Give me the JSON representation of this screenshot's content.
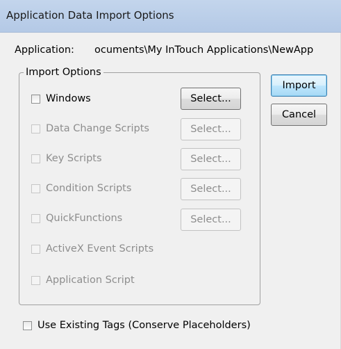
{
  "window": {
    "title": "Application Data Import Options"
  },
  "application": {
    "label": "Application:",
    "path": "ocuments\\My InTouch Applications\\NewApp"
  },
  "import_options": {
    "group_label": "Import Options",
    "items": [
      {
        "label": "Windows",
        "checked": false,
        "enabled": true,
        "select_label": "Select...",
        "select_enabled": true
      },
      {
        "label": "Data Change Scripts",
        "checked": false,
        "enabled": false,
        "select_label": "Select...",
        "select_enabled": false
      },
      {
        "label": "Key Scripts",
        "checked": false,
        "enabled": false,
        "select_label": "Select...",
        "select_enabled": false
      },
      {
        "label": "Condition Scripts",
        "checked": false,
        "enabled": false,
        "select_label": "Select...",
        "select_enabled": false
      },
      {
        "label": "QuickFunctions",
        "checked": false,
        "enabled": false,
        "select_label": "Select...",
        "select_enabled": false
      },
      {
        "label": "ActiveX Event Scripts",
        "checked": false,
        "enabled": false
      },
      {
        "label": "Application Script",
        "checked": false,
        "enabled": false
      }
    ]
  },
  "buttons": {
    "import_label": "Import",
    "cancel_label": "Cancel"
  },
  "use_existing_tags": {
    "label": "Use Existing Tags (Conserve Placeholders)",
    "checked": false
  }
}
